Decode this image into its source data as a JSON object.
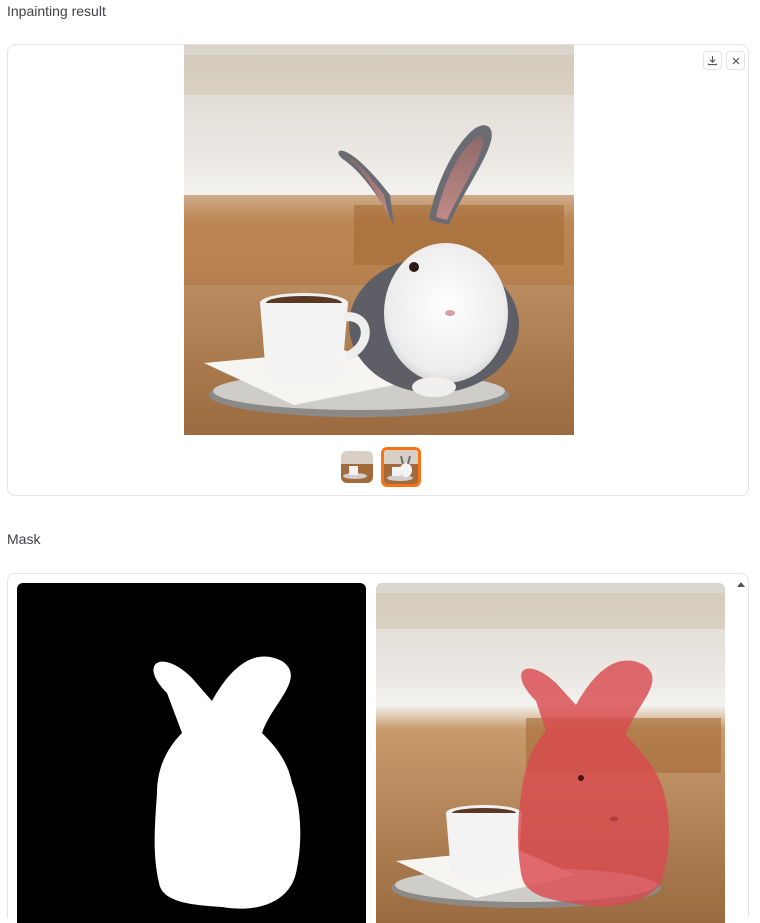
{
  "result": {
    "label": "Inpainting result",
    "download_icon": "download-icon",
    "close_icon": "close-icon",
    "thumbnails": [
      "thumbnail-1",
      "thumbnail-2"
    ],
    "selected_thumbnail": 2
  },
  "mask": {
    "label": "Mask",
    "tiles": [
      "mask-image",
      "mask-overlay-image"
    ],
    "scroll_icon": "scroll-up-icon"
  },
  "colors": {
    "accent": "#f97316",
    "mask_overlay": "#e0484f",
    "border": "#e4e4e7"
  }
}
